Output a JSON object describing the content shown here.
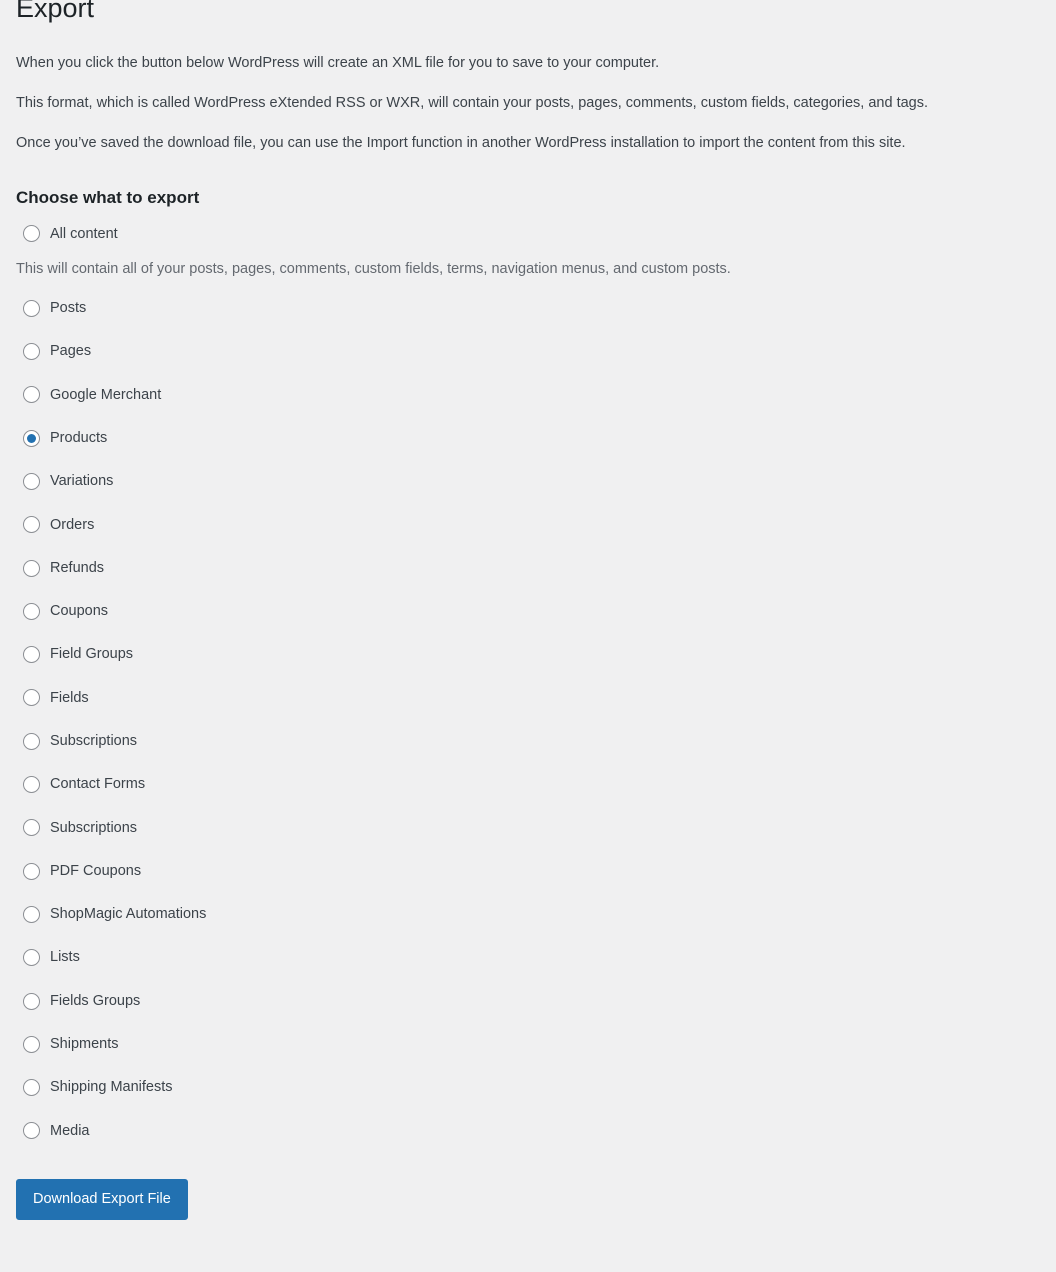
{
  "page": {
    "title": "Export",
    "paragraphs": [
      "When you click the button below WordPress will create an XML file for you to save to your computer.",
      "This format, which is called WordPress eXtended RSS or WXR, will contain your posts, pages, comments, custom fields, categories, and tags.",
      "Once you’ve saved the download file, you can use the Import function in another WordPress installation to import the content from this site."
    ]
  },
  "chooser": {
    "heading": "Choose what to export",
    "all_content_description": "This will contain all of your posts, pages, comments, custom fields, terms, navigation menus, and custom posts.",
    "selected": "Products",
    "options": [
      {
        "label": "All content",
        "checked": false
      },
      {
        "label": "Posts",
        "checked": false
      },
      {
        "label": "Pages",
        "checked": false
      },
      {
        "label": "Google Merchant",
        "checked": false
      },
      {
        "label": "Products",
        "checked": true
      },
      {
        "label": "Variations",
        "checked": false
      },
      {
        "label": "Orders",
        "checked": false
      },
      {
        "label": "Refunds",
        "checked": false
      },
      {
        "label": "Coupons",
        "checked": false
      },
      {
        "label": "Field Groups",
        "checked": false
      },
      {
        "label": "Fields",
        "checked": false
      },
      {
        "label": "Subscriptions",
        "checked": false
      },
      {
        "label": "Contact Forms",
        "checked": false
      },
      {
        "label": "Subscriptions",
        "checked": false
      },
      {
        "label": "PDF Coupons",
        "checked": false
      },
      {
        "label": "ShopMagic Automations",
        "checked": false
      },
      {
        "label": "Lists",
        "checked": false
      },
      {
        "label": "Fields Groups",
        "checked": false
      },
      {
        "label": "Shipments",
        "checked": false
      },
      {
        "label": "Shipping Manifests",
        "checked": false
      },
      {
        "label": "Media",
        "checked": false
      }
    ]
  },
  "submit": {
    "download_label": "Download Export File"
  },
  "colors": {
    "background": "#f0f0f1",
    "accent": "#2271b1",
    "text": "#3c434a",
    "heading": "#1d2327",
    "muted": "#646970",
    "radio_border": "#8c8f94"
  }
}
